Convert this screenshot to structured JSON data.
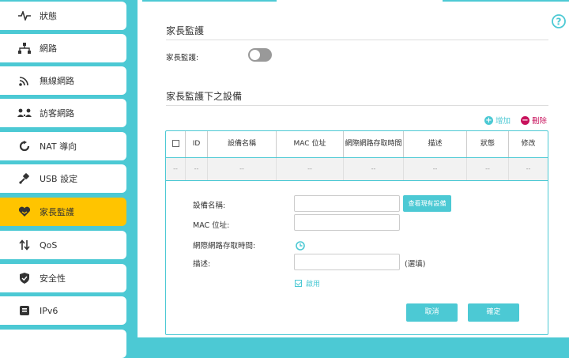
{
  "sidebar": {
    "items": [
      {
        "label": "狀態",
        "icon": "pulse-icon",
        "active": false
      },
      {
        "label": "網路",
        "icon": "network-icon",
        "active": false
      },
      {
        "label": "無線網路",
        "icon": "wireless-icon",
        "active": false
      },
      {
        "label": "訪客網路",
        "icon": "guest-network-icon",
        "active": false
      },
      {
        "label": "NAT 導向",
        "icon": "nat-icon",
        "active": false
      },
      {
        "label": "USB 設定",
        "icon": "usb-icon",
        "active": false
      },
      {
        "label": "家長監護",
        "icon": "heart-icon",
        "active": true
      },
      {
        "label": "QoS",
        "icon": "qos-arrows-icon",
        "active": false
      },
      {
        "label": "安全性",
        "icon": "shield-icon",
        "active": false
      },
      {
        "label": "IPv6",
        "icon": "ipv6-icon",
        "active": false
      }
    ]
  },
  "parental": {
    "title": "家長監護",
    "toggle_label": "家長監護:",
    "toggle_on": false
  },
  "devices": {
    "title": "家長監護下之設備",
    "add_label": "增加",
    "delete_label": "刪除",
    "columns": [
      "ID",
      "設備名稱",
      "MAC 位址",
      "網際網路存取時間",
      "描述",
      "狀態",
      "修改"
    ],
    "empty_row": [
      "--",
      "--",
      "--",
      "--",
      "--",
      "--",
      "--",
      "--"
    ]
  },
  "form": {
    "device_name_label": "設備名稱:",
    "device_name_value": "",
    "view_devices_label": "查看現有設備",
    "mac_label": "MAC 位址:",
    "mac_value": "",
    "time_label": "網際網路存取時間:",
    "desc_label": "描述:",
    "desc_value": "",
    "optional_note": "(選填)",
    "enable_label": "啟用",
    "enable_checked": true,
    "cancel_label": "取消",
    "ok_label": "確定"
  },
  "colors": {
    "accent": "#4cc9d4",
    "active": "#ffc400",
    "add": "#4cc9d4",
    "delete": "#c8125c"
  }
}
